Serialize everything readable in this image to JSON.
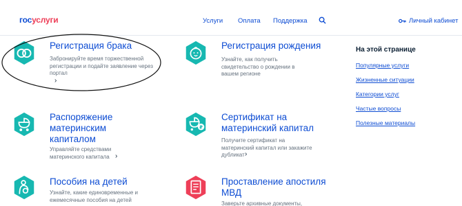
{
  "header": {
    "logo_part1": "гос",
    "logo_part2": "услуги",
    "nav": [
      "Услуги",
      "Оплата",
      "Поддержка"
    ],
    "search_icon": "search-icon",
    "cabinet_icon": "key-icon",
    "cabinet_label": "Личный кабинет"
  },
  "cards": [
    {
      "title": "Регистрация брака",
      "desc": "Забронируйте время торжественной регистрации и подайте заявление через портал",
      "icon": "rings-icon"
    },
    {
      "title": "Регистрация рождения",
      "desc": "Узнайте, как получить свидетельство о рождении в вашем регионе",
      "icon": "baby-icon"
    },
    {
      "title": "Распоряжение материнским капиталом",
      "desc": "Управляйте средствами материнского капитала",
      "icon": "stroller-icon"
    },
    {
      "title": "Сертификат на материнский капитал",
      "desc": "Получите сертификат на материнский капитал или закажите дубликат",
      "icon": "stroller-ruble-icon"
    },
    {
      "title": "Пособия на детей",
      "desc": "Узнайте, какие единовременные и ежемесячные пособия на детей",
      "icon": "mother-child-icon"
    },
    {
      "title": "Проставление апостиля МВД",
      "desc": "Заверьте архивные документы,",
      "icon": "document-icon"
    }
  ],
  "aside": {
    "title": "На этой странице",
    "links": [
      "Популярные услуги",
      "Жизненные ситуации",
      "Категории услуг",
      "Частые вопросы",
      "Полезные материалы"
    ]
  },
  "colors": {
    "brand_blue": "#0d4cd3",
    "brand_red": "#ee3f58",
    "icon_teal": "#17b8b1",
    "text_gray": "#66727f"
  }
}
